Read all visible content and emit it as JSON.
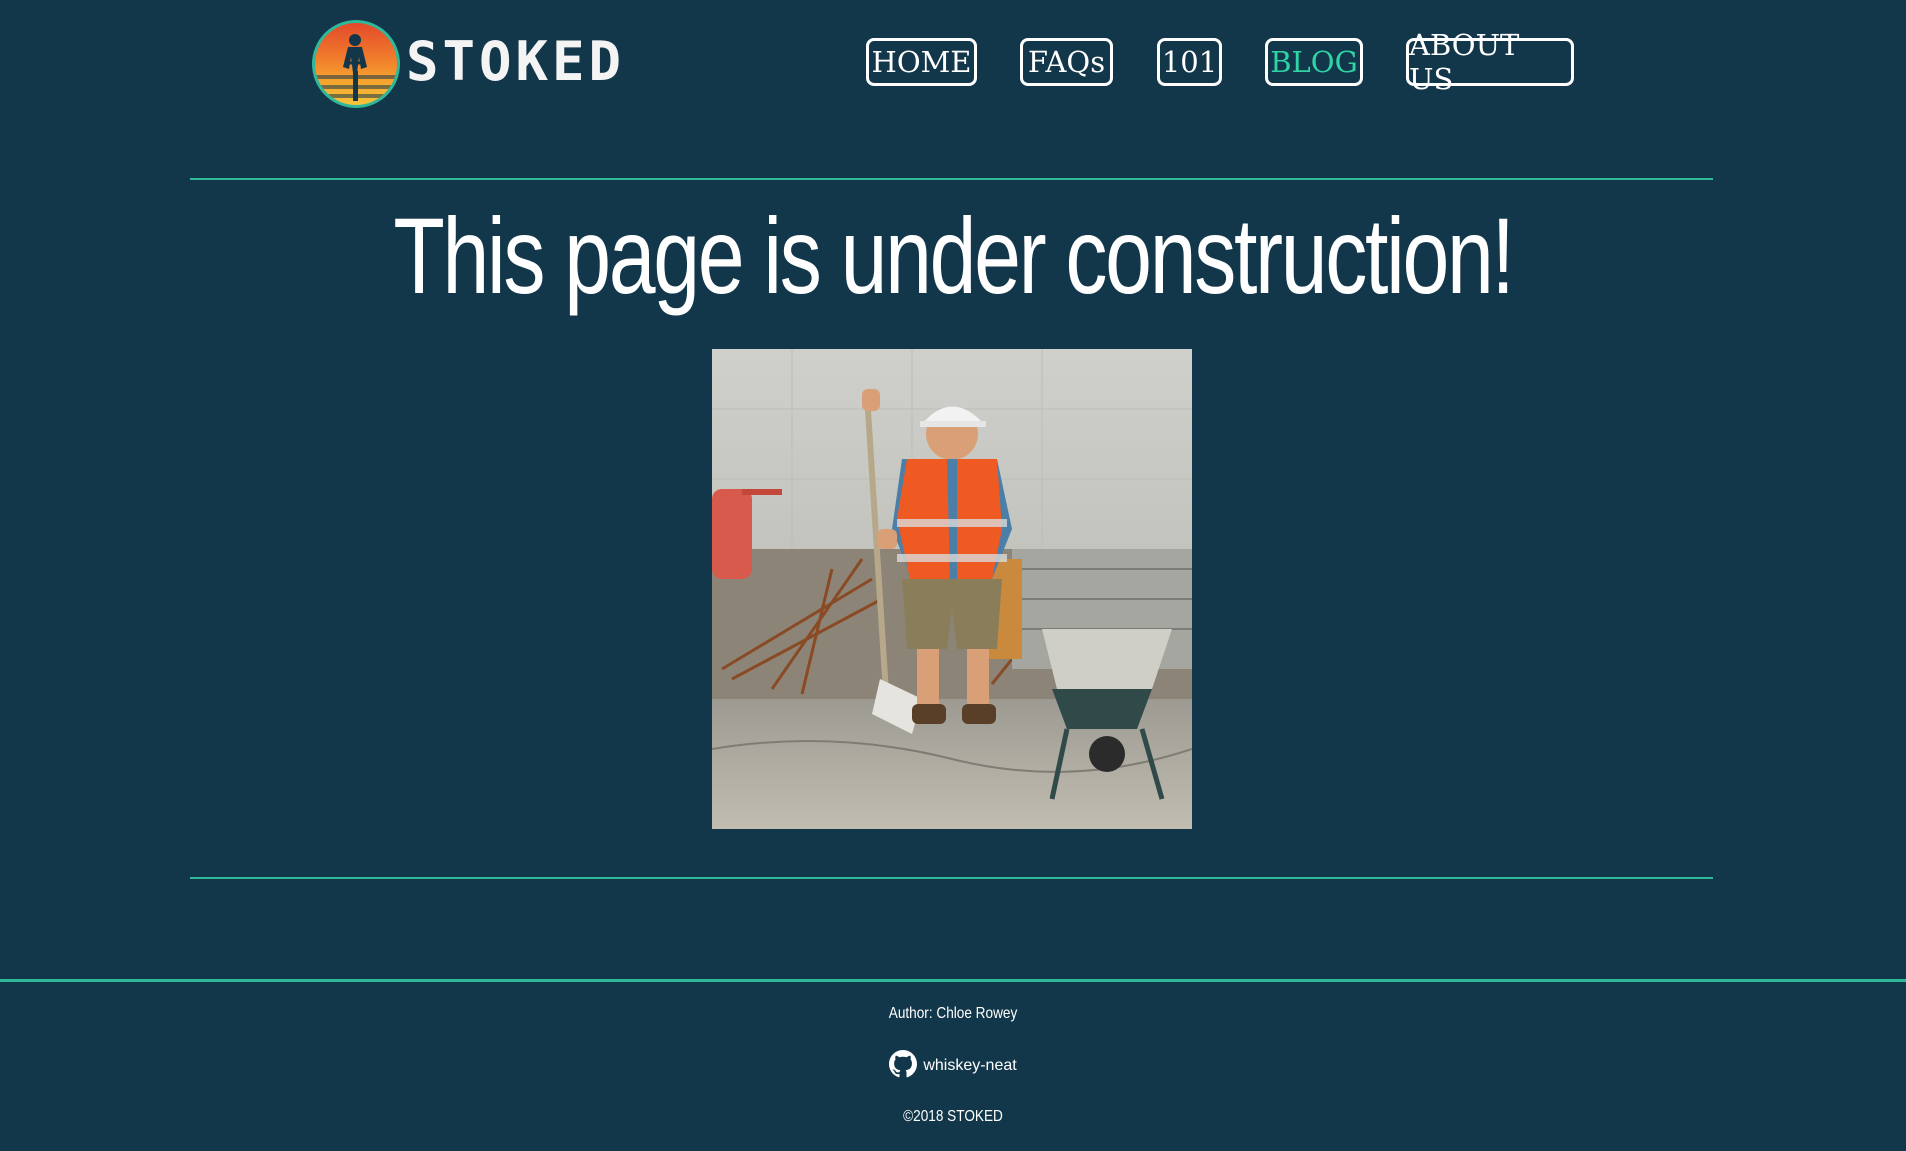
{
  "brand": {
    "name": "STOKED"
  },
  "nav": {
    "items": [
      {
        "label": "HOME",
        "active": false
      },
      {
        "label": "FAQs",
        "active": false
      },
      {
        "label": "101",
        "active": false
      },
      {
        "label": "BLOG",
        "active": true
      },
      {
        "label": "ABOUT US",
        "active": false
      }
    ]
  },
  "main": {
    "title": "This page is under construction!",
    "image_alt": "construction worker shoveling"
  },
  "footer": {
    "author": "Author: Chloe Rowey",
    "github_label": "whiskey-neat",
    "copyright": "©2018 STOKED"
  },
  "colors": {
    "background": "#13374a",
    "accent": "#2fb89a",
    "active_nav": "#2fd3a6",
    "text": "#ffffff"
  },
  "icons": {
    "github": "github-icon"
  }
}
